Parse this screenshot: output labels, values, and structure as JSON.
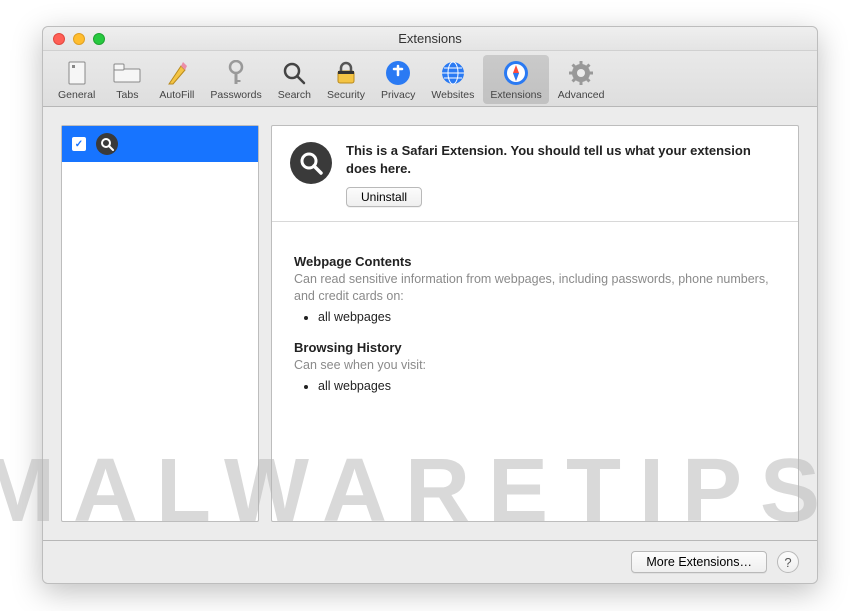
{
  "window": {
    "title": "Extensions"
  },
  "toolbar": {
    "items": [
      {
        "label": "General"
      },
      {
        "label": "Tabs"
      },
      {
        "label": "AutoFill"
      },
      {
        "label": "Passwords"
      },
      {
        "label": "Search"
      },
      {
        "label": "Security"
      },
      {
        "label": "Privacy"
      },
      {
        "label": "Websites"
      },
      {
        "label": "Extensions"
      },
      {
        "label": "Advanced"
      }
    ]
  },
  "sidebar": {
    "item_checked": "✓"
  },
  "detail": {
    "description": "This is a Safari Extension. You should tell us what your extension does here.",
    "uninstall_label": "Uninstall"
  },
  "permissions": {
    "section1": {
      "title": "Webpage Contents",
      "subtitle": "Can read sensitive information from webpages, including passwords, phone numbers, and credit cards on:",
      "item": "all webpages"
    },
    "section2": {
      "title": "Browsing History",
      "subtitle": "Can see when you visit:",
      "item": "all webpages"
    }
  },
  "footer": {
    "more_label": "More Extensions…",
    "help_label": "?"
  },
  "watermark": "MALWARETIPS"
}
